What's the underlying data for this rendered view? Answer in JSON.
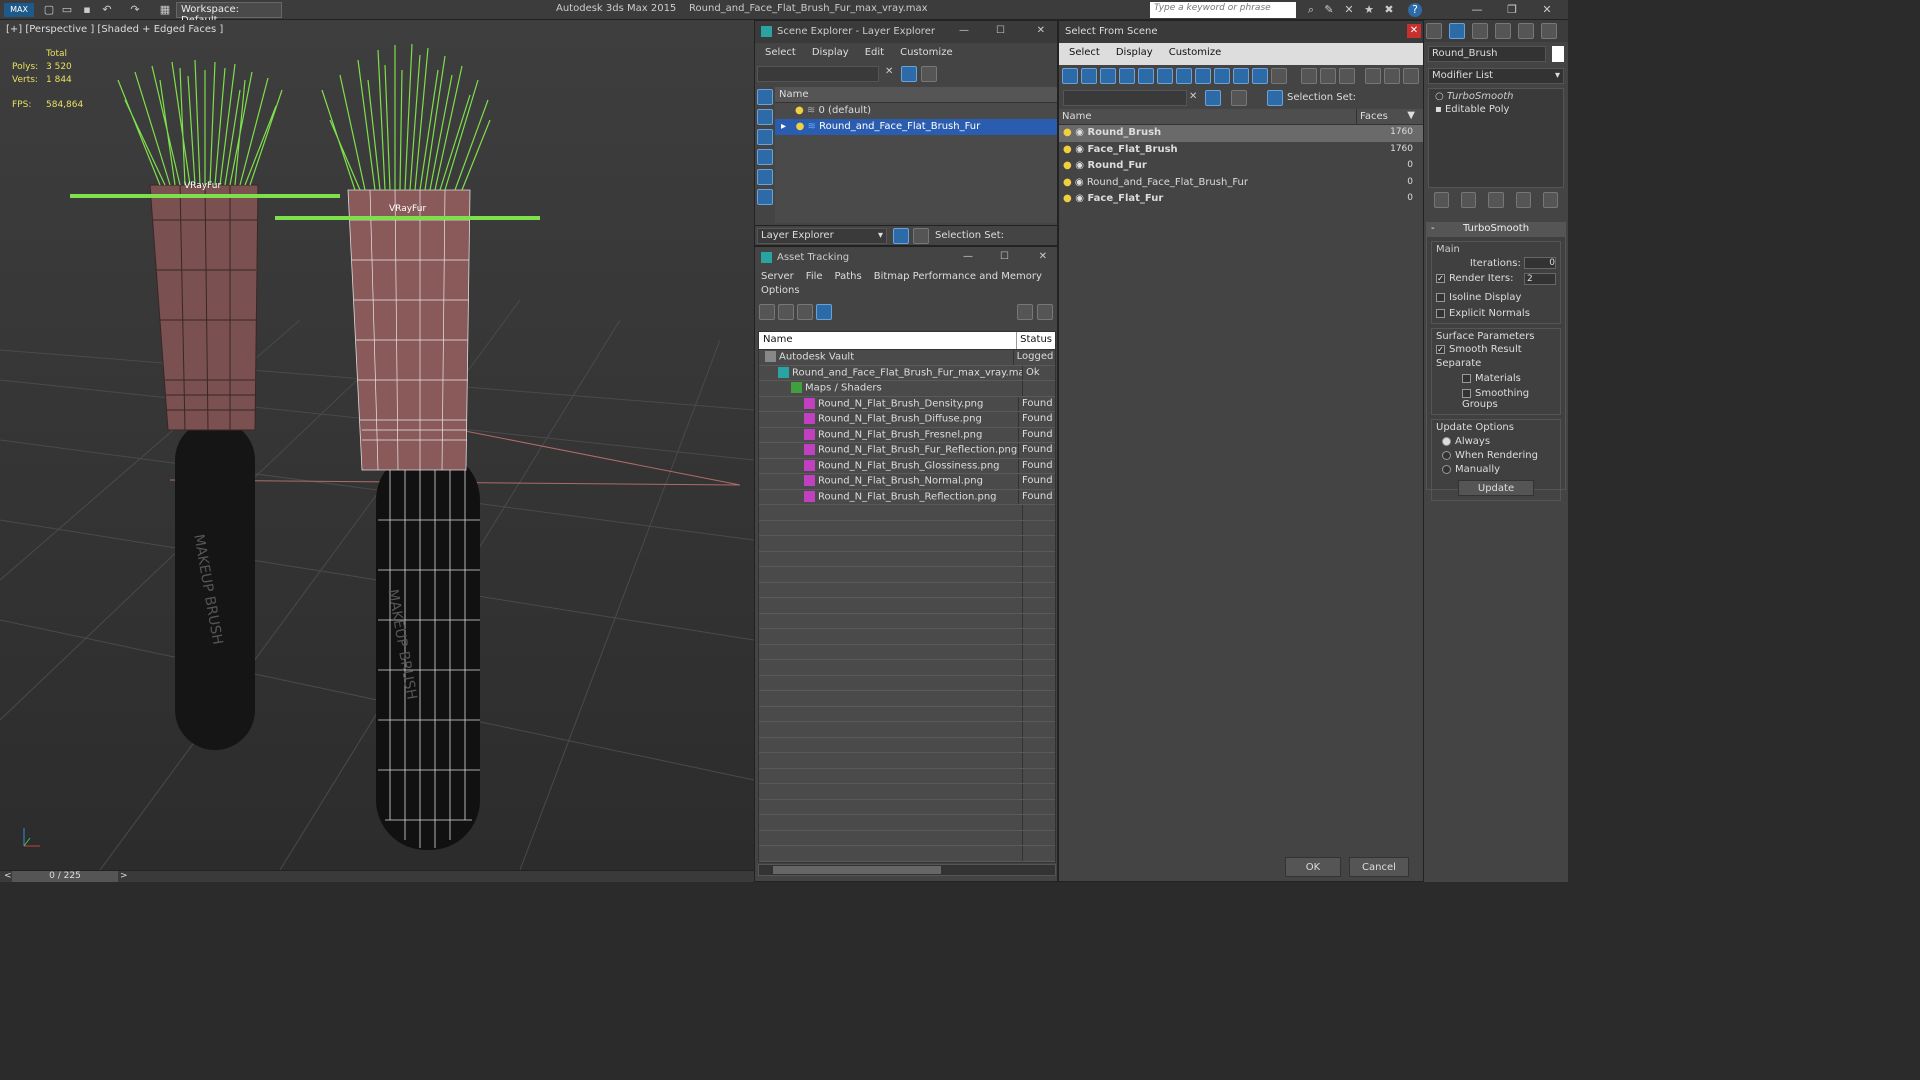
{
  "app": {
    "title": "Autodesk 3ds Max  2015",
    "file": "Round_and_Face_Flat_Brush_Fur_max_vray.max",
    "workspace": "Workspace: Default",
    "search_placeholder": "Type a keyword or phrase"
  },
  "viewport": {
    "label": "[+] [Perspective ] [Shaded + Edged Faces ]",
    "stats": {
      "total": "Total",
      "polys_label": "Polys:",
      "polys": "3 520",
      "verts_label": "Verts:",
      "verts": "1 844",
      "fps_label": "FPS:",
      "fps": "584,864"
    },
    "fur_label_1": "VRayFur",
    "fur_label_2": "VRayFur",
    "brush_text": "MAKEUP BRUSH"
  },
  "timeline": {
    "frame": "0 / 225",
    "prev": "<",
    "next": ">"
  },
  "scene_explorer": {
    "title": "Scene Explorer - Layer Explorer",
    "menu": [
      "Select",
      "Display",
      "Edit",
      "Customize"
    ],
    "col_name": "Name",
    "layers": [
      "0 (default)",
      "Round_and_Face_Flat_Brush_Fur"
    ],
    "footer_dropdown": "Layer Explorer",
    "selection_set": "Selection Set:"
  },
  "asset_tracking": {
    "title": "Asset Tracking",
    "menu": [
      "Server",
      "File",
      "Paths",
      "Bitmap Performance and Memory"
    ],
    "menu2": "Options",
    "col_name": "Name",
    "col_status": "Status",
    "rows": [
      {
        "name": "Autodesk Vault",
        "status": "Logged",
        "indent": 1
      },
      {
        "name": "Round_and_Face_Flat_Brush_Fur_max_vray.max",
        "status": "Ok",
        "indent": 2
      },
      {
        "name": "Maps / Shaders",
        "status": "",
        "indent": 3
      },
      {
        "name": "Round_N_Flat_Brush_Density.png",
        "status": "Found",
        "indent": 4
      },
      {
        "name": "Round_N_Flat_Brush_Diffuse.png",
        "status": "Found",
        "indent": 4
      },
      {
        "name": "Round_N_Flat_Brush_Fresnel.png",
        "status": "Found",
        "indent": 4
      },
      {
        "name": "Round_N_Flat_Brush_Fur_Reflection.png",
        "status": "Found",
        "indent": 4
      },
      {
        "name": "Round_N_Flat_Brush_Glossiness.png",
        "status": "Found",
        "indent": 4
      },
      {
        "name": "Round_N_Flat_Brush_Normal.png",
        "status": "Found",
        "indent": 4
      },
      {
        "name": "Round_N_Flat_Brush_Reflection.png",
        "status": "Found",
        "indent": 4
      }
    ]
  },
  "select_scene": {
    "title": "Select From Scene",
    "menu": [
      "Select",
      "Display",
      "Customize"
    ],
    "selection_set": "Selection Set:",
    "col_name": "Name",
    "col_faces": "Faces",
    "rows": [
      {
        "name": "Round_Brush",
        "faces": "1760",
        "bold": true
      },
      {
        "name": "Face_Flat_Brush",
        "faces": "1760",
        "bold": true
      },
      {
        "name": "Round_Fur",
        "faces": "0",
        "bold": true
      },
      {
        "name": "Round_and_Face_Flat_Brush_Fur",
        "faces": "0",
        "bold": false
      },
      {
        "name": "Face_Flat_Fur",
        "faces": "0",
        "bold": true
      }
    ],
    "ok": "OK",
    "cancel": "Cancel"
  },
  "modifier": {
    "object_name": "Round_Brush",
    "modifier_list": "Modifier List",
    "stack": [
      "TurboSmooth",
      "Editable Poly"
    ],
    "rollout_title": "TurboSmooth",
    "main": "Main",
    "iterations_label": "Iterations:",
    "iterations": "0",
    "render_iters_label": "Render Iters:",
    "render_iters": "2",
    "isoline": "Isoline Display",
    "explicit": "Explicit Normals",
    "surface": "Surface Parameters",
    "smooth_result": "Smooth Result",
    "separate": "Separate",
    "materials": "Materials",
    "smoothing": "Smoothing Groups",
    "update_options": "Update Options",
    "always": "Always",
    "when_rendering": "When Rendering",
    "manually": "Manually",
    "update": "Update"
  },
  "colors": {
    "accent": "#2d6aa8",
    "fur": "#7ee04a",
    "handle_top": "#8a5a5a",
    "selection": "#2a5db0"
  }
}
